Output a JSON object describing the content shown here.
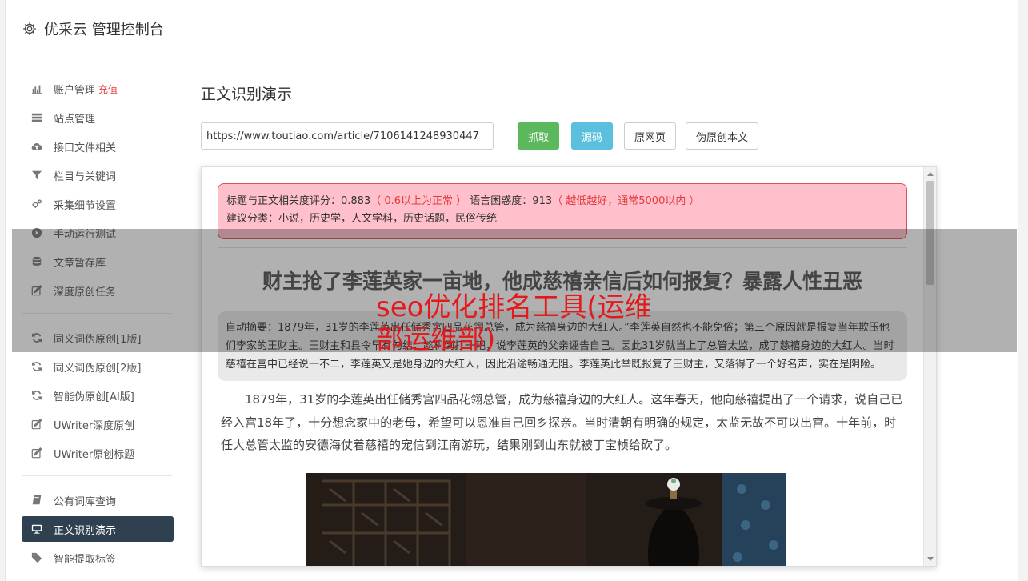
{
  "header": {
    "title": "优采云 管理控制台",
    "icon": "gear-icon"
  },
  "sidebar": {
    "group1": [
      {
        "label": "账户管理",
        "extra": "充值",
        "icon": "bar-chart-icon"
      },
      {
        "label": "站点管理",
        "icon": "server-icon"
      },
      {
        "label": "接口文件相关",
        "icon": "cloud-upload-icon"
      },
      {
        "label": "栏目与关键词",
        "icon": "filter-icon"
      },
      {
        "label": "采集细节设置",
        "icon": "gears-icon"
      },
      {
        "label": "手动运行测试",
        "icon": "play-circle-icon"
      },
      {
        "label": "文章暂存库",
        "icon": "database-icon"
      },
      {
        "label": "深度原创任务",
        "icon": "edit-icon"
      }
    ],
    "group2": [
      {
        "label": "同义词伪原创[1版]",
        "icon": "refresh-icon"
      },
      {
        "label": "同义词伪原创[2版]",
        "icon": "refresh-icon"
      },
      {
        "label": "智能伪原创[AI版]",
        "icon": "refresh-icon"
      },
      {
        "label": "UWriter深度原创",
        "icon": "edit-icon"
      },
      {
        "label": "UWriter原创标题",
        "icon": "edit-icon"
      }
    ],
    "group3": [
      {
        "label": "公有词库查询",
        "icon": "book-icon"
      },
      {
        "label": "正文识别演示",
        "icon": "monitor-icon",
        "active": true
      },
      {
        "label": "智能提取标签",
        "icon": "tag-icon"
      }
    ]
  },
  "main": {
    "page_title": "正文识别演示",
    "url_value": "https://www.toutiao.com/article/7106141248930447",
    "buttons": {
      "fetch": "抓取",
      "source": "源码",
      "original": "原网页",
      "pseudo": "伪原创本文"
    },
    "score": {
      "line1_a": "标题与正文相关度评分：0.883",
      "line1_b": "（ 0.6以上为正常 ）",
      "line1_c": " 语言困惑度：913",
      "line1_d": "（ 越低越好，通常5000以内 ）",
      "line2": "建议分类：小说，历史学，人文学科，历史话题，民俗传统"
    },
    "article_title": "财主抢了李莲英家一亩地，他成慈禧亲信后如何报复？暴露人性丑恶",
    "summary_a": "自动摘要：1879年，31岁的李莲英出任储秀宫四品花翎总管，成为慈禧身边的大红人。”李莲英自然也不能免俗；第三个原因就是报复当年欺压他们李家的王财主。王财主和县令早有勾结，趁机倒打一耙，说李莲英的父亲诬告自己。因此31岁就当上了总管太监，成了慈禧",
    "summary_b": "身边的大红人。当时慈禧在宫中已经说一不二，李莲英又是她身边的大红人，因此沿途畅通无阻。李莲英此举既报复了王财主，又落得了一个好名声，实在是阴险。",
    "paragraph": "1879年，31岁的李莲英出任储秀宫四品花翎总管，成为慈禧身边的大红人。这年春天，他向慈禧提出了一个请求，说自己已经入宫18年了，十分想念家中的老母，希望可以恩准自己回乡探亲。当时清朝有明确的规定，太监无故不可以出宫。十年前，时任大总管太监的安德海仗着慈禧的宠信到江南游玩，结果刚到山东就被丁宝桢给砍了。"
  },
  "overlay_text": "seo优化排名工具(运维部运维部)"
}
